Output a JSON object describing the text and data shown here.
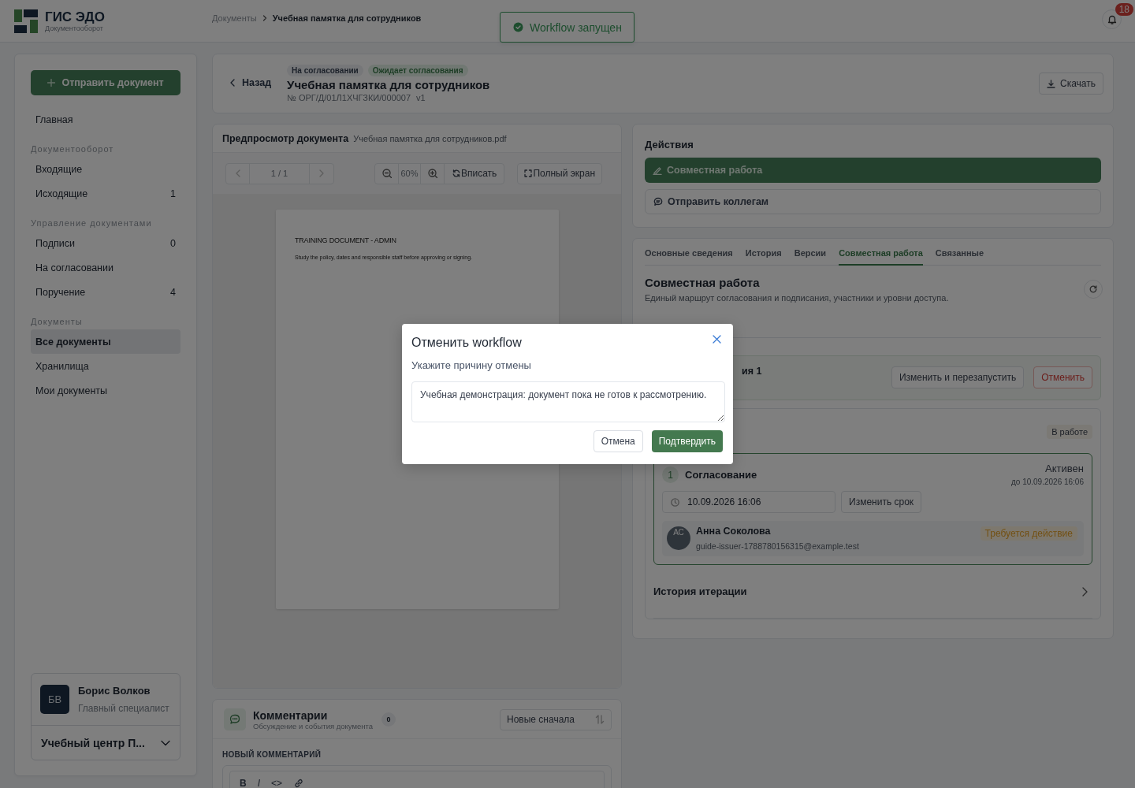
{
  "header": {
    "logo_title": "ГИС ЭДО",
    "logo_subtitle": "Документооборот",
    "breadcrumbs": [
      {
        "label": "Документы",
        "current": false
      },
      {
        "label": "Учебная памятка для сотрудников",
        "current": true
      }
    ],
    "notification_count": "18"
  },
  "toast": {
    "text": "Workflow запущен"
  },
  "sidebar": {
    "primary_button": "Отправить документ",
    "items": [
      {
        "kind": "link",
        "label": "Главная",
        "selected": false
      },
      {
        "kind": "heading",
        "label": "Документооборот"
      },
      {
        "kind": "link",
        "label": "Входящие",
        "selected": false
      },
      {
        "kind": "link",
        "label": "Исходящие",
        "count": "1",
        "selected": false
      },
      {
        "kind": "heading",
        "label": "Управление документами"
      },
      {
        "kind": "link",
        "label": "Подписи",
        "count": "0",
        "selected": false
      },
      {
        "kind": "link",
        "label": "На согласовании",
        "selected": false
      },
      {
        "kind": "link",
        "label": "Поручение",
        "count": "4",
        "selected": false
      },
      {
        "kind": "heading",
        "label": "Документы"
      },
      {
        "kind": "link",
        "label": "Все документы",
        "selected": true
      },
      {
        "kind": "link",
        "label": "Хранилища",
        "selected": false
      },
      {
        "kind": "link",
        "label": "Мои документы",
        "selected": false
      }
    ],
    "user": {
      "initials": "БВ",
      "name": "Борис Волков",
      "role": "Главный специалист",
      "organization": "Учебный центр П..."
    }
  },
  "document": {
    "back": "Назад",
    "badges": [
      {
        "label": "На согласовании",
        "kind": "neutral"
      },
      {
        "label": "Ожидает согласования",
        "kind": "success"
      }
    ],
    "title": "Учебная памятка для сотрудников",
    "number": "№ ОРГ/Д/01Л1ХЧГЗКИ/000007",
    "version": "v1",
    "download": "Скачать"
  },
  "preview": {
    "title": "Предпросмотр документа",
    "file": "Учебная памятка для сотрудников.pdf",
    "page_indicator": "1 / 1",
    "zoom": "60%",
    "fit": "Вписать",
    "fullscreen": "Полный экран",
    "page_heading": "TRAINING DOCUMENT - ADMIN",
    "page_text": "Study the policy, dates and responsible staff before approving or signing."
  },
  "actions": {
    "title": "Действия",
    "buttons": [
      {
        "label": "Совместная работа",
        "kind": "primary"
      },
      {
        "label": "Отправить коллегам",
        "kind": "secondary"
      }
    ]
  },
  "tabs": [
    {
      "label": "Основные сведения",
      "selected": false
    },
    {
      "label": "История",
      "selected": false
    },
    {
      "label": "Версии",
      "selected": false
    },
    {
      "label": "Совместная работа",
      "selected": true
    },
    {
      "label": "Связанные",
      "selected": false
    }
  ],
  "collaboration": {
    "title": "Совместная работа",
    "subtitle": "Единый маршрут согласования и подписания, участники и уровни доступа.",
    "iteration": {
      "title": "ия 1",
      "buttons": [
        {
          "label": "Изменить и перезапустить",
          "kind": "default"
        },
        {
          "label": "Отменить",
          "kind": "danger"
        }
      ]
    },
    "status": "В работе",
    "stage": {
      "number": "1",
      "name": "Согласование",
      "state": "Активен",
      "due": "до 10.09.2026 16:06",
      "deadline": "10.09.2026 16:06",
      "change_button": "Изменить срок",
      "participant": {
        "initials": "АС",
        "name": "Анна Соколова",
        "email": "guide-issuer-1788780156315@example.test",
        "status": "Требуется действие"
      }
    },
    "history": "История итерации"
  },
  "comments": {
    "title": "Комментарии",
    "subtitle": "Обсуждение и события документа",
    "count": "0",
    "sort": "Новые сначала",
    "new_label": "НОВЫЙ КОММЕНТАРИЙ",
    "toolbar": [
      "B",
      "I",
      "<>"
    ]
  },
  "modal": {
    "title": "Отменить workflow",
    "label": "Укажите причину отмены",
    "value": "Учебная демонстрация: документ пока не готов к рассмотрению.",
    "cancel": "Отмена",
    "confirm": "Подтвердить"
  }
}
